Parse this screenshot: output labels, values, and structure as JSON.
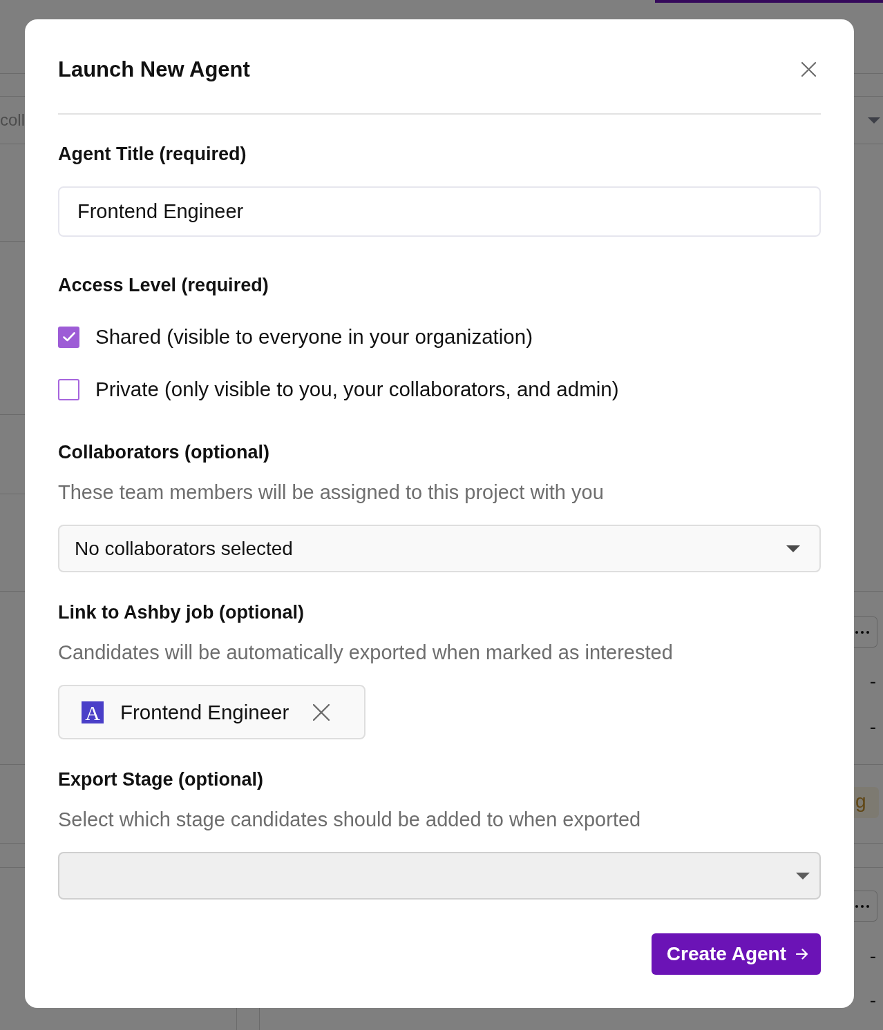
{
  "background": {
    "toolbar_text": "coll",
    "status_tag": "g",
    "cells": [
      "-",
      "-",
      "-",
      "-"
    ]
  },
  "dialog": {
    "title": "Launch New Agent",
    "fields": [
      {
        "kind": "text",
        "label": "Agent Title (required)",
        "value": "Frontend Engineer"
      },
      {
        "kind": "checkboxes",
        "label": "Access Level (required)",
        "options": [
          {
            "label": "Shared (visible to everyone in your organization)",
            "checked": true
          },
          {
            "label": "Private (only visible to you, your collaborators, and admin)",
            "checked": false
          }
        ]
      },
      {
        "kind": "select",
        "label": "Collaborators (optional)",
        "description": "These team members will be assigned to this project with you",
        "value": "No collaborators selected",
        "disabled": false
      },
      {
        "kind": "job_link",
        "label": "Link to Ashby job (optional)",
        "description": "Candidates will be automatically exported when marked as interested",
        "job": {
          "logo_letter": "A",
          "title": "Frontend Engineer"
        }
      },
      {
        "kind": "select",
        "label": "Export Stage (optional)",
        "description": "Select which stage candidates should be added to when exported",
        "disabled": true
      }
    ],
    "submit": {
      "label": "Create Agent"
    }
  }
}
